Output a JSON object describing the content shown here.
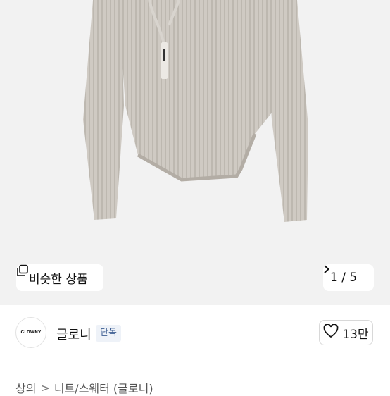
{
  "product_image": {
    "alt_icon": "ribbed-knit-sweater-image",
    "similar_products_label": "비슷한 상품",
    "similar_icon": "similar-copy-icon",
    "pager": {
      "current": "1",
      "separator": "/",
      "total": "5"
    },
    "next_icon": "chevron-right-icon"
  },
  "brand": {
    "logo_text": "GLOWNY",
    "name": "글로니",
    "badge": "단독",
    "like_icon": "heart-outline-icon",
    "like_count": "13만"
  },
  "breadcrumb": {
    "items": [
      "상의",
      "니트/스웨터 (글로니)"
    ],
    "separator": ">"
  },
  "colors": {
    "hero_background": "#f2f2f2",
    "badge_text": "#3e5e92",
    "badge_background": "#eef2f8"
  }
}
